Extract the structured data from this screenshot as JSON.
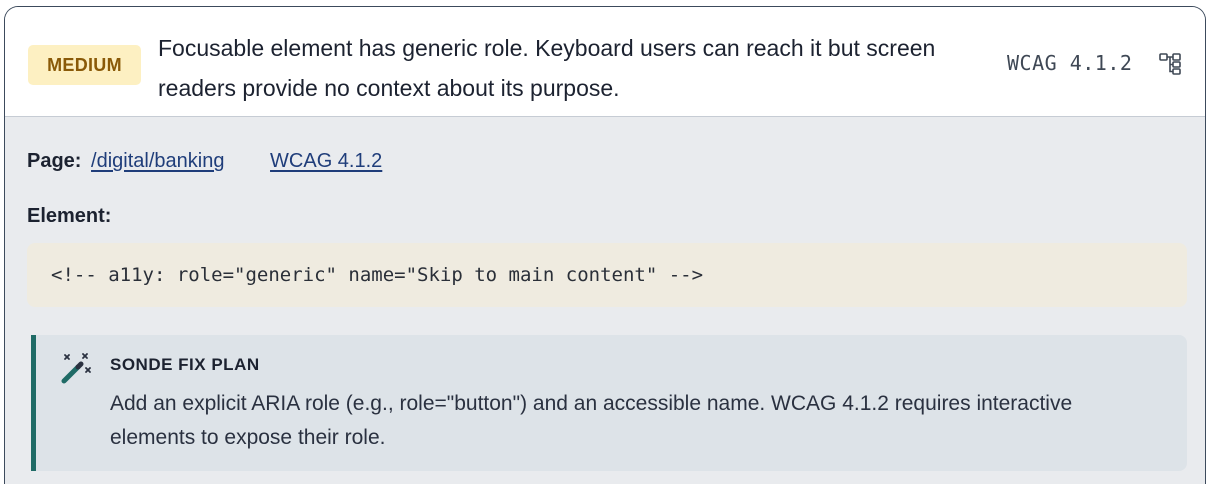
{
  "issue": {
    "severity": "MEDIUM",
    "summary": "Focusable element has generic role. Keyboard users can reach it but screen readers provide no context about its purpose.",
    "wcag_ref": "WCAG 4.1.2",
    "tree_icon": "tree-structure-icon"
  },
  "details": {
    "page_label": "Page:",
    "page_link": "/digital/banking",
    "wcag_link": "WCAG 4.1.2",
    "element_label": "Element:",
    "element_code": "<!-- a11y: role=\"generic\" name=\"Skip to main content\" -->"
  },
  "fix_plan": {
    "icon": "magic-wand-icon",
    "title": "SONDE FIX PLAN",
    "body": "Add an explicit ARIA role (e.g., role=\"button\") and an accessible name. WCAG 4.1.2 requires interactive elements to expose their role."
  },
  "colors": {
    "badge_bg": "#fdf0c2",
    "badge_text": "#8a5a08",
    "link": "#1f3d7a",
    "fix_accent": "#1f6b66",
    "fix_bg": "#dde3e8",
    "code_bg": "#efebe0"
  }
}
